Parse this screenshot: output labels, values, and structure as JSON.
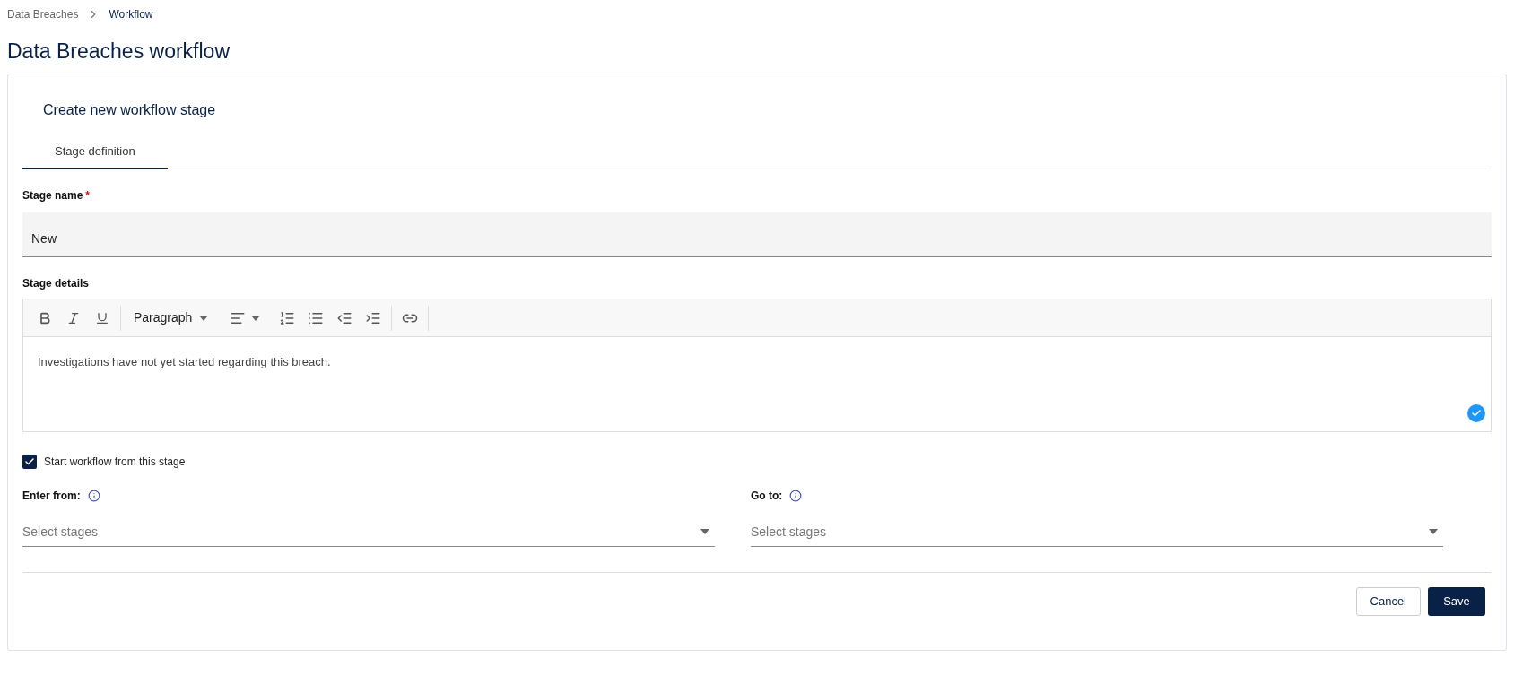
{
  "breadcrumb": [
    {
      "label": "Data Breaches",
      "current": false
    },
    {
      "label": "Workflow",
      "current": true
    }
  ],
  "page_title": "Data Breaches workflow",
  "card": {
    "title": "Create new workflow stage",
    "tabs": [
      {
        "label": "Stage definition",
        "selected": true
      }
    ],
    "stage_name": {
      "label": "Stage name",
      "required": true,
      "required_mark": "*",
      "value": "New"
    },
    "stage_details": {
      "label": "Stage details",
      "format": "Paragraph",
      "content": "Investigations have not yet started regarding this breach."
    },
    "start_checkbox": {
      "label": "Start workflow from this stage",
      "checked": true
    },
    "selects": [
      {
        "label": "Enter from:",
        "placeholder": "Select stages"
      },
      {
        "label": "Go to:",
        "placeholder": "Select stages"
      }
    ],
    "buttons": [
      {
        "label": "Cancel",
        "kind": "secondary"
      },
      {
        "label": "Save",
        "kind": "primary"
      }
    ]
  }
}
